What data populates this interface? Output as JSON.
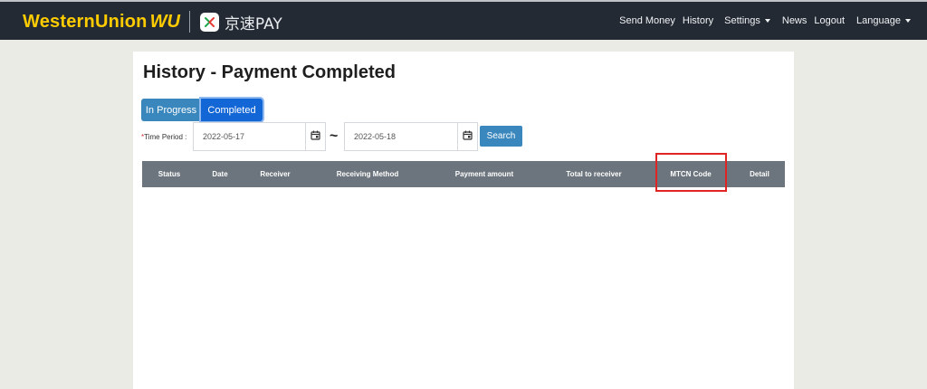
{
  "navbar": {
    "brand_name": "WesternUnion",
    "brand_mark": "WU",
    "partner_name": "京速PAY",
    "links": [
      {
        "label": "Send Money"
      },
      {
        "label": "History"
      },
      {
        "label": "Settings",
        "dropdown": true
      },
      {
        "label": "News"
      },
      {
        "label": "Logout"
      },
      {
        "label": "Language",
        "dropdown": true
      }
    ]
  },
  "page": {
    "title": "History - Payment Completed"
  },
  "tabs": {
    "in_progress": "In Progress",
    "completed": "Completed",
    "active": "Completed"
  },
  "filter": {
    "required_mark": "*",
    "time_period_label": "Time Period :",
    "start_date": "2022-05-17",
    "end_date": "2022-05-18",
    "separator": "~",
    "search_label": "Search"
  },
  "table": {
    "columns": [
      "Status",
      "Date",
      "Receiver",
      "Receiving Method",
      "Payment amount",
      "Total to receiver",
      "MTCN Code",
      "Detail"
    ],
    "rows": [],
    "highlighted_column": "MTCN Code"
  },
  "colors": {
    "navbar_bg": "#232a34",
    "brand_yellow": "#ffcc00",
    "button_blue": "#3a87bd",
    "active_tab_blue": "#1366d6",
    "table_header_bg": "#6c757d",
    "highlight_red": "#e02323"
  },
  "icons": {
    "calendar": "calendar-icon",
    "dropdown": "caret-down-icon"
  }
}
